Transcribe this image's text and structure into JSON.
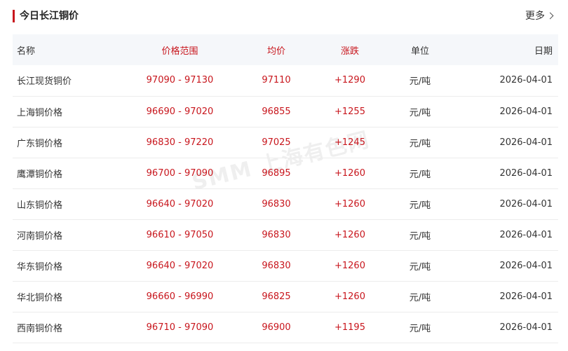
{
  "header": {
    "title": "今日长江铜价",
    "more_label": "更多"
  },
  "watermark": "SMM 上海有色网",
  "table": {
    "columns": [
      "名称",
      "价格范围",
      "均价",
      "涨跌",
      "单位",
      "日期"
    ],
    "rows": [
      [
        "长江现货铜价",
        "97090 - 97130",
        "97110",
        "+1290",
        "元/吨",
        "2026-04-01"
      ],
      [
        "上海铜价格",
        "96690 - 97020",
        "96855",
        "+1255",
        "元/吨",
        "2026-04-01"
      ],
      [
        "广东铜价格",
        "96830 - 97220",
        "97025",
        "+1245",
        "元/吨",
        "2026-04-01"
      ],
      [
        "鹰潭铜价格",
        "96700 - 97090",
        "96895",
        "+1260",
        "元/吨",
        "2026-04-01"
      ],
      [
        "山东铜价格",
        "96640 - 97020",
        "96830",
        "+1260",
        "元/吨",
        "2026-04-01"
      ],
      [
        "河南铜价格",
        "96610 - 97050",
        "96830",
        "+1260",
        "元/吨",
        "2026-04-01"
      ],
      [
        "华东铜价格",
        "96640 - 97020",
        "96830",
        "+1260",
        "元/吨",
        "2026-04-01"
      ],
      [
        "华北铜价格",
        "96660 - 96990",
        "96825",
        "+1260",
        "元/吨",
        "2026-04-01"
      ],
      [
        "西南铜价格",
        "96710 - 97090",
        "96900",
        "+1195",
        "元/吨",
        "2026-04-01"
      ]
    ]
  },
  "colors": {
    "accent": "#c8161d",
    "header_bg": "#f5f7fa"
  }
}
